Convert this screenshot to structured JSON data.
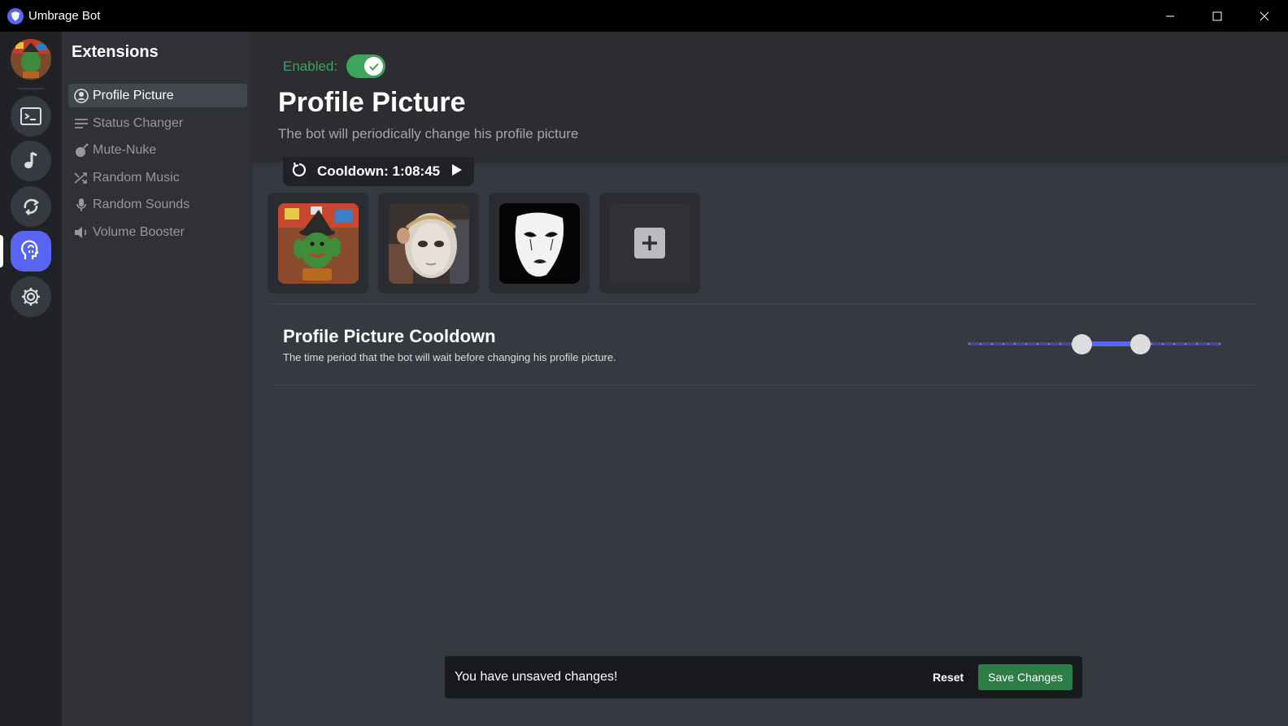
{
  "window": {
    "title": "Umbrage Bot",
    "controls": [
      "minimize-icon",
      "maximize-icon",
      "close-icon"
    ]
  },
  "rail": {
    "items": [
      {
        "name": "terminal-icon",
        "active": false
      },
      {
        "name": "music-note-icon",
        "active": false
      },
      {
        "name": "repeat-icon",
        "active": false
      },
      {
        "name": "extensions-icon",
        "active": true
      },
      {
        "name": "gear-icon",
        "active": false
      }
    ]
  },
  "sidebar": {
    "heading": "Extensions",
    "items": [
      {
        "label": "Profile Picture",
        "icon": "user-circle-icon",
        "active": true
      },
      {
        "label": "Status Changer",
        "icon": "lines-icon",
        "active": false
      },
      {
        "label": "Mute-Nuke",
        "icon": "bomb-icon",
        "active": false
      },
      {
        "label": "Random Music",
        "icon": "shuffle-icon",
        "active": false
      },
      {
        "label": "Random Sounds",
        "icon": "microphone-icon",
        "active": false
      },
      {
        "label": "Volume Booster",
        "icon": "speaker-icon",
        "active": false
      }
    ]
  },
  "main": {
    "enabled_label": "Enabled:",
    "enabled": true,
    "title": "Profile Picture",
    "description": "The bot will periodically change his profile picture",
    "cooldown_text": "Cooldown: 1:08:45",
    "pictures": [
      "cactus-toy-image",
      "white-mask-face-image",
      "mime-mask-image"
    ],
    "add_picture_icon": "plus-icon",
    "setting": {
      "title": "Profile Picture Cooldown",
      "description": "The time period that the bot will wait before changing his profile picture.",
      "range_low": 0.45,
      "range_high": 0.68
    }
  },
  "unsaved_bar": {
    "message": "You have unsaved changes!",
    "reset_label": "Reset",
    "save_label": "Save Changes"
  },
  "colors": {
    "accent": "#5865f2",
    "success": "#3ba55d",
    "save_button": "#2d7d46"
  }
}
